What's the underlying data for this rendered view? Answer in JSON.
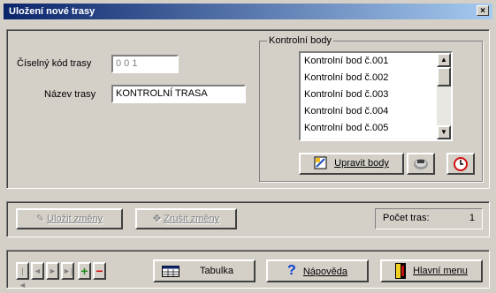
{
  "window": {
    "title": "Uložení nové trasy",
    "close_icon": "×"
  },
  "form": {
    "code_label": "Číselný kód trasy",
    "code_value": "0 0 1",
    "name_label": "Název trasy",
    "name_value": "KONTROLNÍ TRASA"
  },
  "points_group": {
    "title": "Kontrolní body",
    "items": [
      "Kontrolní bod č.001",
      "Kontrolní bod č.002",
      "Kontrolní bod č.003",
      "Kontrolní bod č.004",
      "Kontrolní bod č.005"
    ],
    "edit_label": "Upravit body"
  },
  "actions": {
    "save_label": "Uložit změny",
    "cancel_label": "Zrušit změny",
    "count_label": "Počet tras:",
    "count_value": "1"
  },
  "toolbar": {
    "nav_first": "|◄",
    "nav_prev": "◄",
    "nav_next": "►",
    "nav_last": "►|",
    "add_icon": "+",
    "remove_icon": "−",
    "table_label": "Tabulka",
    "help_label": "Nápověda",
    "menu_label": "Hlavní menu"
  },
  "colors": {
    "titlebar_start": "#0a246a",
    "titlebar_end": "#a6caf0",
    "face": "#d4d0c8",
    "add": "#1f8a1f",
    "remove": "#d01010"
  }
}
